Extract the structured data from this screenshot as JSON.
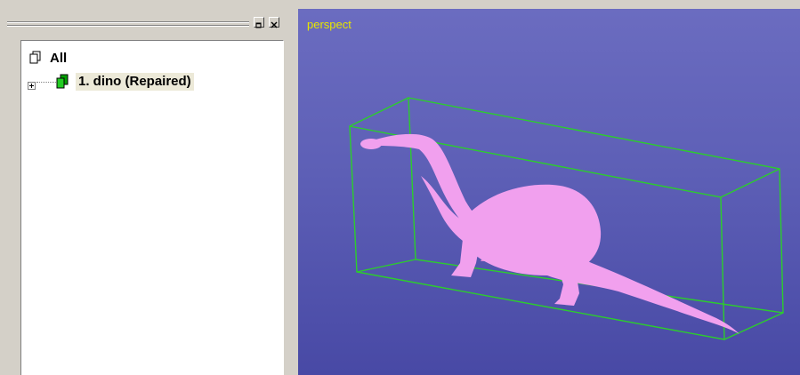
{
  "tree": {
    "root_label": "All",
    "items": [
      {
        "label": "1. dino (Repaired)",
        "expander": "+"
      }
    ]
  },
  "viewport": {
    "label": "perspect",
    "label_color": "#e6e600",
    "model_color": "#f1a0ee",
    "bbox_color": "#2ccd2c",
    "background": "#5d5fb6"
  },
  "panel_buttons": {
    "restore": "restore-icon",
    "close": "close-icon"
  }
}
